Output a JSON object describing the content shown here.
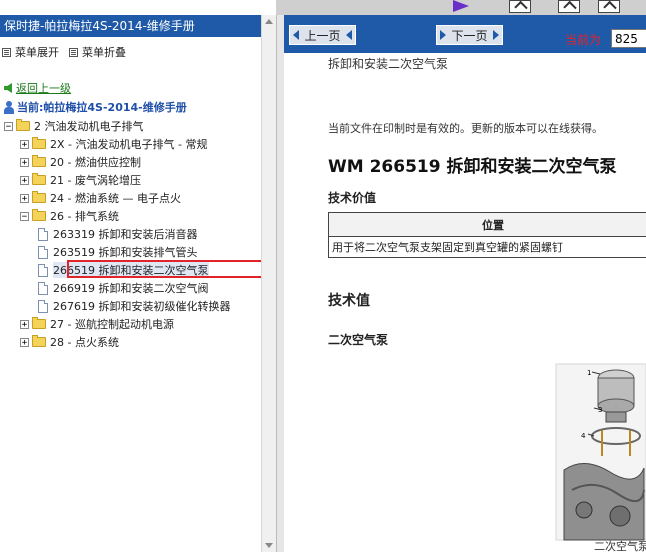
{
  "left_pane": {
    "title": "保时捷-帕拉梅拉4S-2014-维修手册",
    "menu_expand": "菜单展开",
    "menu_collapse": "菜单折叠",
    "back_link": "返回上一级",
    "current_label": "当前:帕拉梅拉4S-2014-维修手册",
    "tree": [
      {
        "label": "2 汽油发动机电子排气",
        "level": 0,
        "type": "folder",
        "state": "expanded"
      },
      {
        "label": "2X - 汽油发动机电子排气 - 常规",
        "level": 1,
        "type": "folder",
        "state": "collapsed"
      },
      {
        "label": "20 - 燃油供应控制",
        "level": 1,
        "type": "folder",
        "state": "collapsed"
      },
      {
        "label": "21 - 废气涡轮增压",
        "level": 1,
        "type": "folder",
        "state": "collapsed"
      },
      {
        "label": "24 - 燃油系统 — 电子点火",
        "level": 1,
        "type": "folder",
        "state": "collapsed"
      },
      {
        "label": "26 - 排气系统",
        "level": 1,
        "type": "folder",
        "state": "expanded"
      },
      {
        "label": "263319 拆卸和安装后消音器",
        "level": 2,
        "type": "doc"
      },
      {
        "label": "263519 拆卸和安装排气管头",
        "level": 2,
        "type": "doc"
      },
      {
        "label": "266519 拆卸和安装二次空气泵",
        "level": 2,
        "type": "doc",
        "selected": true
      },
      {
        "label": "266919 拆卸和安装二次空气阀",
        "level": 2,
        "type": "doc"
      },
      {
        "label": "267619 拆卸和安装初级催化转换器",
        "level": 2,
        "type": "doc"
      },
      {
        "label": "27 - 巡航控制起动机电源",
        "level": 1,
        "type": "folder",
        "state": "collapsed"
      },
      {
        "label": "28 - 点火系统",
        "level": 1,
        "type": "folder",
        "state": "collapsed"
      }
    ]
  },
  "nav": {
    "prev_label": "上一页",
    "next_label": "下一页",
    "current_page_label": "当前为",
    "current_page_value": "825"
  },
  "document": {
    "heading": "拆卸和安装二次空气泵",
    "notice": "当前文件在印制时是有效的。更新的版本可以在线获得。",
    "title": "WM 266519 拆卸和安装二次空气泵",
    "section_tech_value": "技术价值",
    "table": {
      "header": "位置",
      "rows": [
        "用于将二次空气泵支架固定到真空罐的紧固螺钉"
      ]
    },
    "section_tech_value_2": "技术值",
    "section_pump": "二次空气泵",
    "figure_caption": "二次空气泵",
    "figure_callouts": [
      "1",
      "3",
      "4"
    ]
  },
  "colors": {
    "title_bar": "#1f5aa8",
    "highlight": "#e0242a",
    "back_link": "#1a7a1a"
  }
}
